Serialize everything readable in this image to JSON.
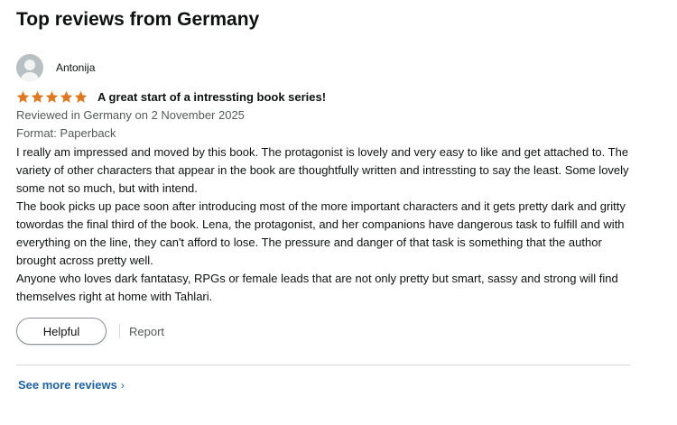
{
  "section": {
    "title": "Top reviews from Germany"
  },
  "review": {
    "profile_name": "Antonija",
    "rating": 5,
    "star_color": "#de7921",
    "title": "A great start of a intressting book series!",
    "meta": "Reviewed in Germany on 2 November 2025",
    "format": "Format: Paperback",
    "body": [
      "I really am impressed and moved by this book. The protagonist is lovely and very easy to like and get attached to. The variety of other characters that appear in the book are thoughtfully written and intressting to say the least. Some lovely some not so much, but with intend.",
      "The book picks up pace soon after introducing most of the more important characters and it gets pretty dark and gritty towordas the final third of the book. Lena, the protagonist, and her companions have dangerous task to fulfill and with everything on the line, they can't afford to lose. The pressure and danger of that task is something that the author brought across pretty well.",
      "Anyone who loves dark fantatasy, RPGs or female leads that are not only pretty but smart, sassy and strong will find themselves right at home with Tahlari."
    ]
  },
  "actions": {
    "helpful_label": "Helpful",
    "report_label": "Report"
  },
  "footer": {
    "see_more_label": "See more reviews",
    "see_more_icon": "chevron-right-icon"
  },
  "colors": {
    "link": "#2162a1",
    "secondary_text": "#565959",
    "avatar_bg": "#b9c0c3"
  }
}
